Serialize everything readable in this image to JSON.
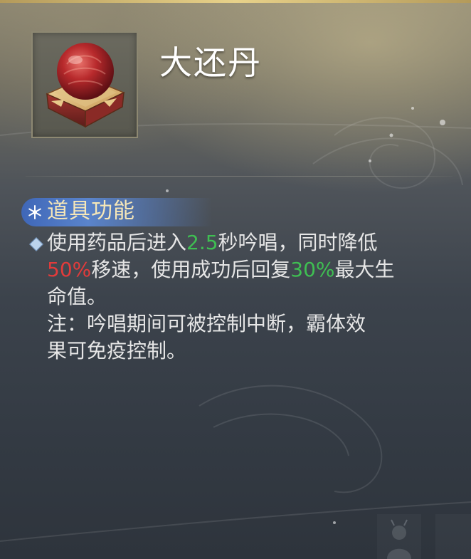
{
  "tooltip": {
    "item_name": "大还丹",
    "section_title": "道具功能",
    "description": {
      "line1": {
        "part1": "使用药品后进入",
        "cast_time": "2.5",
        "part2": "秒吟唱，同时降低"
      },
      "line2": {
        "slow_percent": "50%",
        "part1": "移速，使用成功后回复",
        "heal_percent": "30%",
        "part2": "最大生"
      },
      "line3": "命值。",
      "note_line1": "注：吟唱期间可被控制中断，霸体效",
      "note_line2": "果可免疫控制。"
    }
  },
  "colors": {
    "highlight_green": "#3fbf52",
    "highlight_red": "#e23b3b",
    "section_title": "#f6e7b8",
    "text": "#e6e6e6"
  },
  "icons": {
    "item": "red-pill-on-box-icon",
    "section": "snowflake-icon",
    "bullet": "diamond-bullet-icon"
  }
}
